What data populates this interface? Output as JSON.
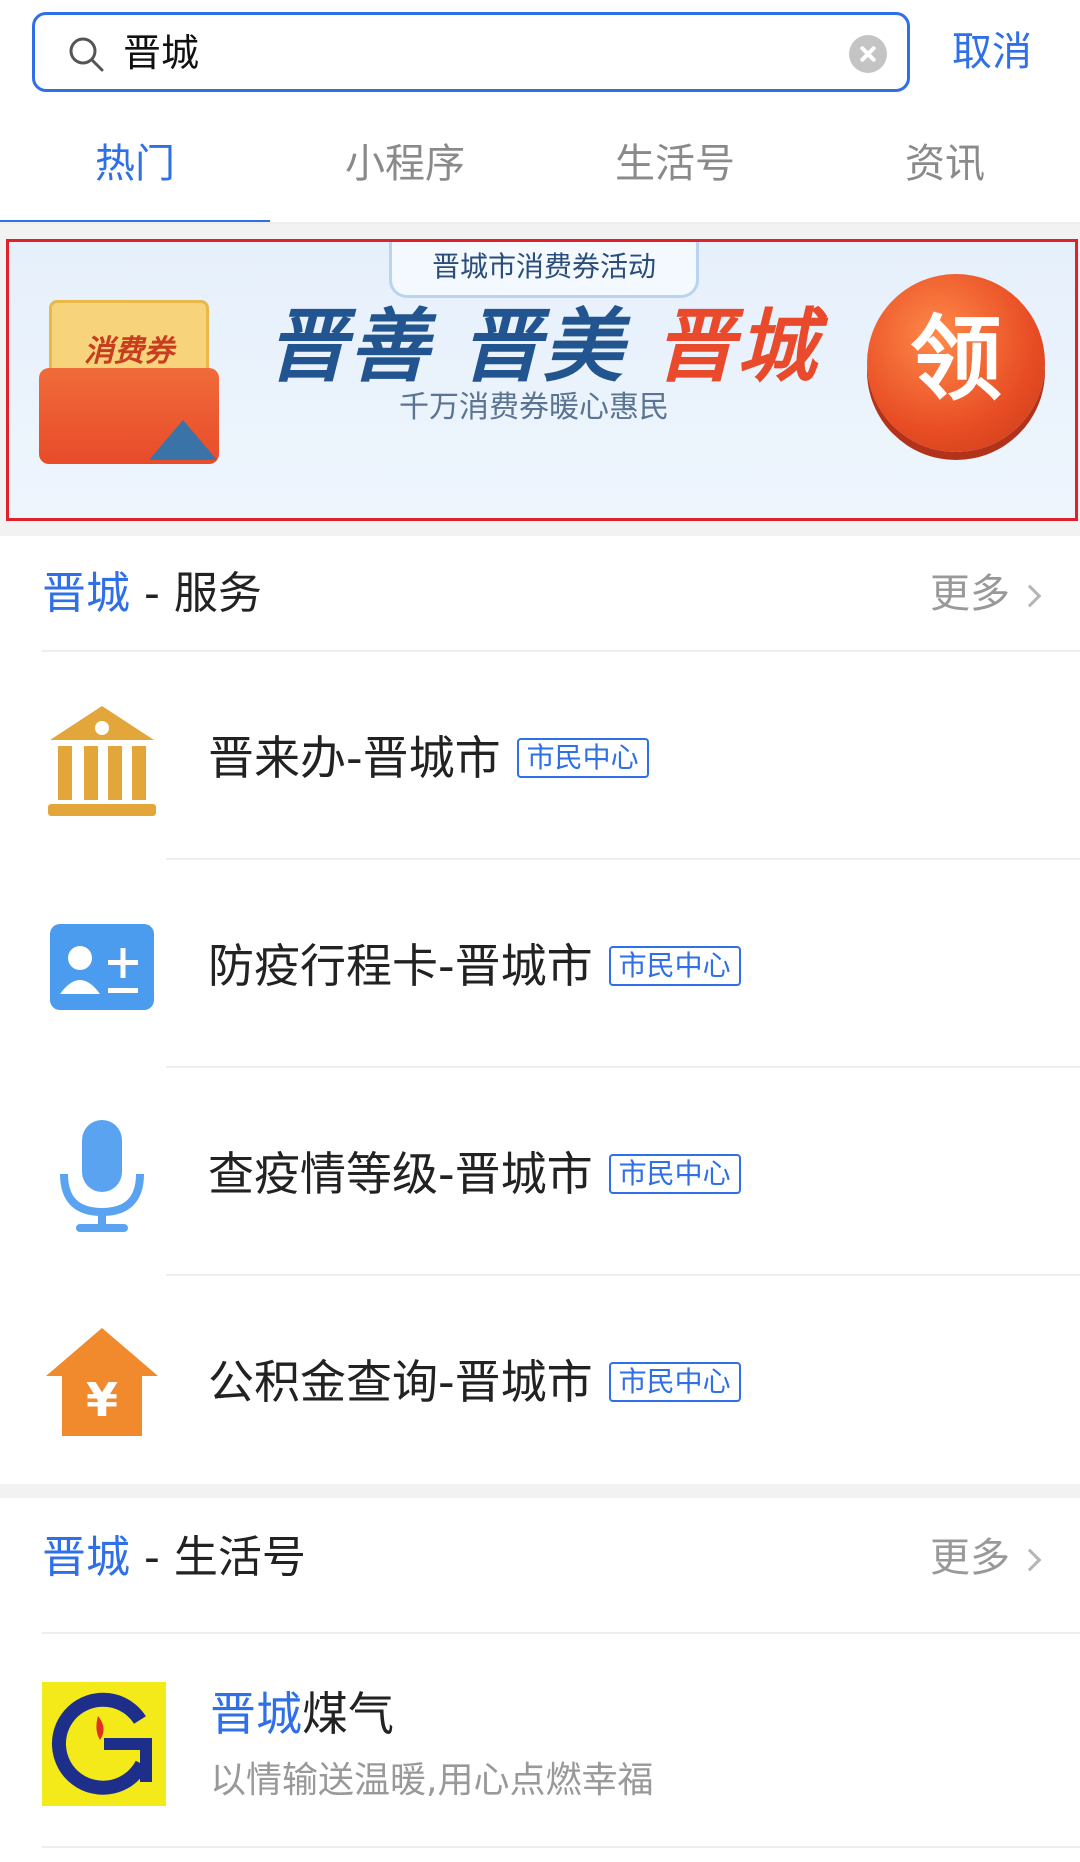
{
  "search": {
    "query": "晋城",
    "cancel_label": "取消"
  },
  "tabs": [
    {
      "label": "热门",
      "active": true
    },
    {
      "label": "小程序",
      "active": false
    },
    {
      "label": "生活号",
      "active": false
    },
    {
      "label": "资讯",
      "active": false
    }
  ],
  "banner": {
    "top_tag": "晋城市消费券活动",
    "coupon_label": "消费券",
    "slogan_part1": "晋善",
    "slogan_part2": "晋美",
    "slogan_part3": "晋城",
    "subtitle": "千万消费券暖心惠民",
    "claim_label": "领"
  },
  "services_section": {
    "keyword": "晋城",
    "title_suffix": " - 服务",
    "more_label": "更多",
    "items": [
      {
        "name": "晋来办-晋城市",
        "badge": "市民中心",
        "icon": "government-building-icon",
        "color": "#e2a63a"
      },
      {
        "name": "防疫行程卡-晋城市",
        "badge": "市民中心",
        "icon": "contact-card-icon",
        "color": "#4b9bef"
      },
      {
        "name": "查疫情等级-晋城市",
        "badge": "市民中心",
        "icon": "microphone-icon",
        "color": "#5aa3f0"
      },
      {
        "name": "公积金查询-晋城市",
        "badge": "市民中心",
        "icon": "yuan-house-icon",
        "color": "#f08a2c"
      }
    ]
  },
  "life_section": {
    "keyword": "晋城",
    "title_suffix": " - 生活号",
    "more_label": "更多",
    "items": [
      {
        "name_keyword": "晋城",
        "name_rest": "煤气",
        "desc": "以情输送温暖,用心点燃幸福",
        "icon": "gas-company-logo-icon"
      }
    ]
  }
}
